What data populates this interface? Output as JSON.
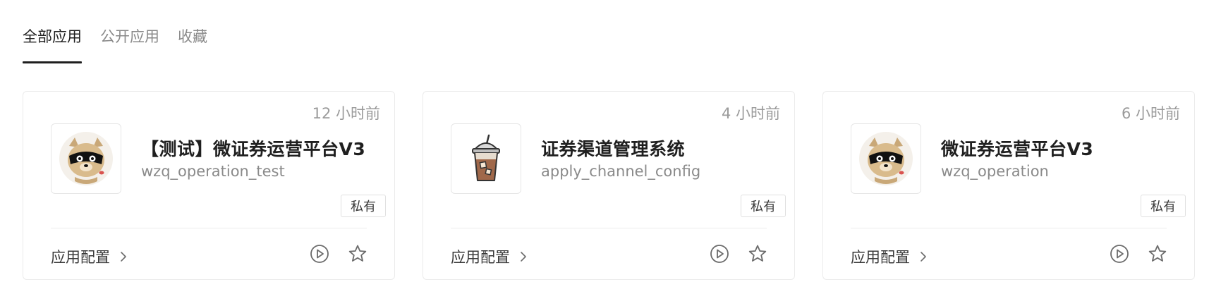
{
  "tabs": [
    {
      "label": "全部应用",
      "active": true
    },
    {
      "label": "公开应用",
      "active": false
    },
    {
      "label": "收藏",
      "active": false
    }
  ],
  "cards": [
    {
      "time": "12 小时前",
      "name": "【测试】微证券运营平台V3",
      "code": "wzq_operation_test",
      "badge": "私有",
      "config_label": "应用配置",
      "icon": "raccoon-mascot-icon"
    },
    {
      "time": "4 小时前",
      "name": "证券渠道管理系统",
      "code": "apply_channel_config",
      "badge": "私有",
      "config_label": "应用配置",
      "icon": "iced-coffee-icon"
    },
    {
      "time": "6 小时前",
      "name": "微证券运营平台V3",
      "code": "wzq_operation",
      "badge": "私有",
      "config_label": "应用配置",
      "icon": "raccoon-mascot-icon"
    }
  ],
  "colors": {
    "text": "#1f1f1f",
    "muted": "#8a8a8a",
    "border": "#ebebeb"
  }
}
